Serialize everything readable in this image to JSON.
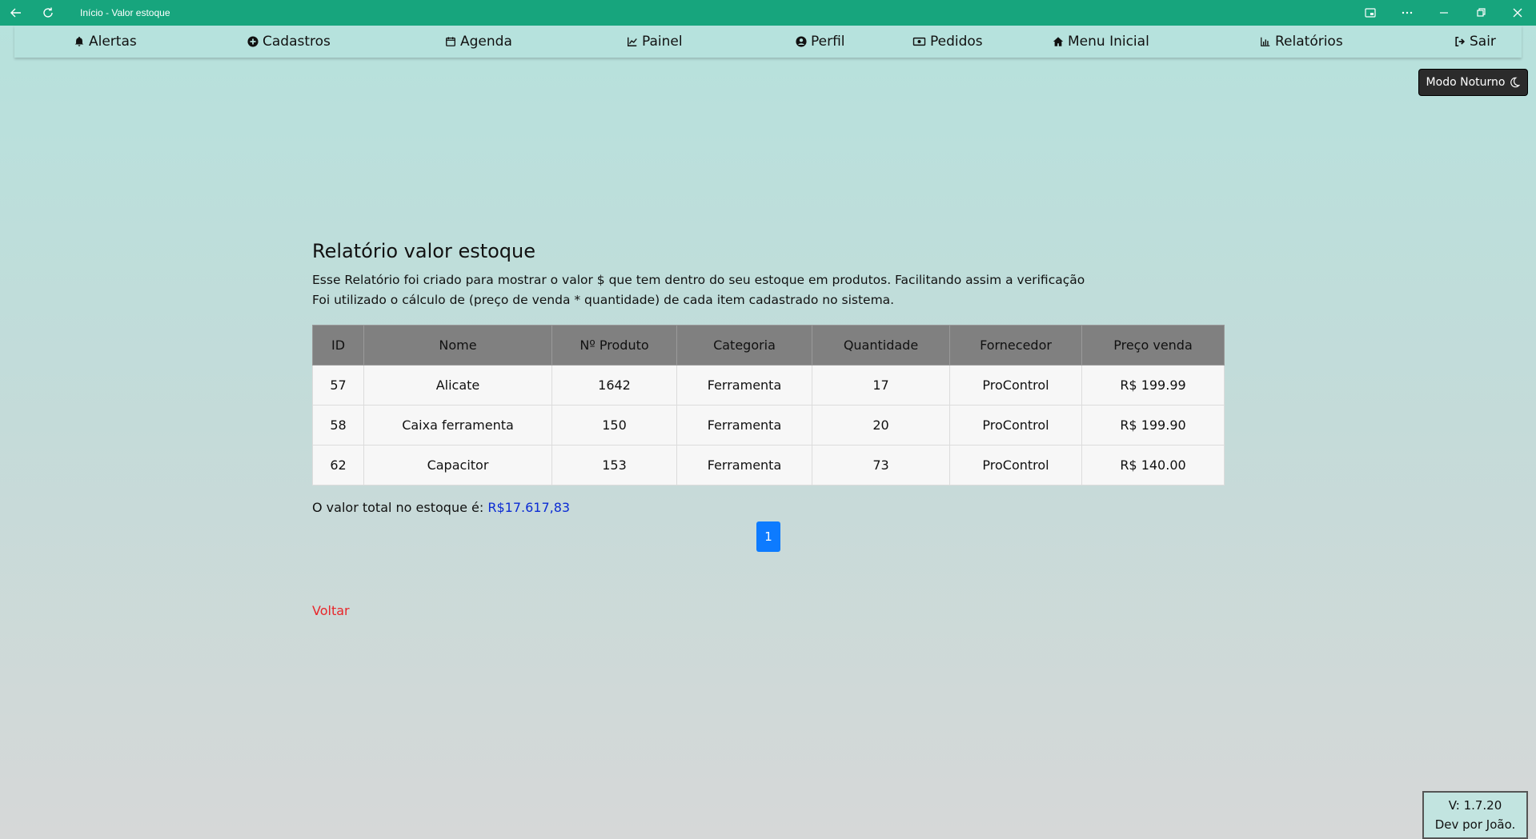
{
  "window": {
    "title": "Início - Valor estoque"
  },
  "nav": {
    "items": [
      {
        "label": "Alertas",
        "icon": "bell-icon"
      },
      {
        "label": "Cadastros",
        "icon": "plus-circle-icon"
      },
      {
        "label": "Agenda",
        "icon": "calendar-icon"
      },
      {
        "label": "Painel",
        "icon": "line-chart-icon"
      },
      {
        "label": "Perfil",
        "icon": "user-circle-icon"
      },
      {
        "label": "Pedidos",
        "icon": "money-bill-icon"
      },
      {
        "label": "Menu Inicial",
        "icon": "home-icon"
      },
      {
        "label": "Relatórios",
        "icon": "bar-chart-icon"
      },
      {
        "label": "Sair",
        "icon": "sign-out-icon"
      }
    ]
  },
  "night_mode": {
    "label": "Modo Noturno",
    "icon": "moon-icon"
  },
  "report": {
    "title": "Relatório valor estoque",
    "desc_line1": "Esse Relatório foi criado para mostrar o valor $ que tem dentro do seu estoque em produtos. Facilitando assim a verificação",
    "desc_line2": "Foi utilizado o cálculo de (preço de venda * quantidade) de cada item cadastrado no sistema.",
    "columns": [
      "ID",
      "Nome",
      "Nº Produto",
      "Categoria",
      "Quantidade",
      "Fornecedor",
      "Preço venda"
    ],
    "rows": [
      [
        "57",
        "Alicate",
        "1642",
        "Ferramenta",
        "17",
        "ProControl",
        "R$ 199.99"
      ],
      [
        "58",
        "Caixa ferramenta",
        "150",
        "Ferramenta",
        "20",
        "ProControl",
        "R$ 199.90"
      ],
      [
        "62",
        "Capacitor",
        "153",
        "Ferramenta",
        "73",
        "ProControl",
        "R$ 140.00"
      ]
    ],
    "total_label": "O valor total no estoque é:",
    "total_value": "R$17.617,83",
    "page": "1",
    "back": "Voltar"
  },
  "footer": {
    "version": "V: 1.7.20",
    "dev": "Dev por João."
  },
  "colors": {
    "titlebar": "#17a57d",
    "accent": "#0d7bff",
    "total": "#0b2bd4",
    "back_link": "#e8262a"
  }
}
